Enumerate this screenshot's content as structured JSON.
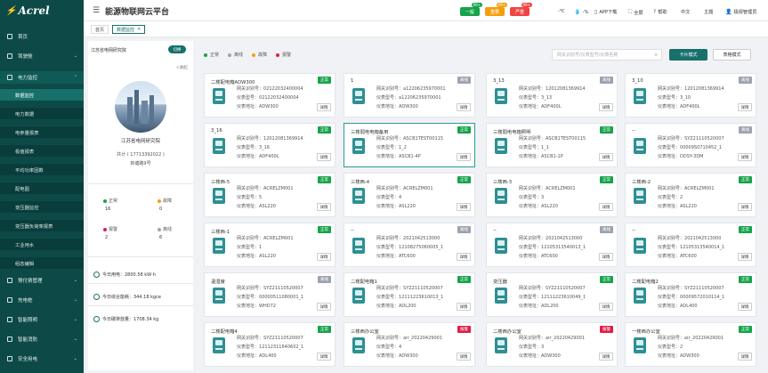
{
  "colors": {
    "sidebar": "#0d4a47",
    "accent": "#17706a",
    "normal": "#16a34a",
    "offline": "#9ca3af",
    "fault": "#f59e0b",
    "alarm": "#e11d48"
  },
  "app": {
    "logo": "Acrel",
    "title": "能源物联网云平台"
  },
  "header": {
    "alarms": [
      {
        "label": "一般",
        "count": "99+",
        "color": "#16a34a"
      },
      {
        "label": "重要",
        "count": "99+",
        "color": "#f59e0b"
      },
      {
        "label": "严重",
        "count": "99+",
        "color": "#ef4444"
      }
    ],
    "temp": "-℃",
    "humidity": "-%",
    "app_download": "APP下载",
    "fullscreen": "全屏",
    "help": "帮助",
    "language": "中文",
    "theme": "主题",
    "account": "极视管理员"
  },
  "sidebar": {
    "items": [
      {
        "label": "首页",
        "icon": "home-icon"
      },
      {
        "label": "驾驶舱",
        "icon": "dashboard-icon"
      },
      {
        "label": "电力监控",
        "icon": "power-icon"
      }
    ],
    "sub_items": [
      {
        "label": "数据监控",
        "active": true
      },
      {
        "label": "电力数据"
      },
      {
        "label": "电参量报表"
      },
      {
        "label": "极值报表"
      },
      {
        "label": "平均功率因数"
      },
      {
        "label": "配电图"
      },
      {
        "label": "变压器监控"
      },
      {
        "label": "变压器负荷率报表"
      },
      {
        "label": "工业用水"
      },
      {
        "label": "组态编辑"
      }
    ],
    "bottom_items": [
      {
        "label": "预付费管理",
        "icon": "prepay-icon"
      },
      {
        "label": "充电桩",
        "icon": "charger-icon"
      },
      {
        "label": "智能照明",
        "icon": "lighting-icon"
      },
      {
        "label": "智能消防",
        "icon": "fire-icon"
      },
      {
        "label": "安全用电",
        "icon": "safety-icon"
      }
    ]
  },
  "tabs": [
    {
      "label": "首页"
    },
    {
      "label": "数据监控",
      "active": true
    }
  ],
  "project": {
    "header": "江苏省电网研究院",
    "switch": "切换",
    "collapse": "<收起",
    "name": "江苏省电网研究院",
    "stations": "共计 ( 17713392022 )",
    "address": "新塘路9号",
    "stats": [
      {
        "label": "正常",
        "value": "16",
        "color": "#16a34a"
      },
      {
        "label": "故障",
        "value": "0",
        "color": "#f59e0b"
      },
      {
        "label": "报警",
        "value": "2",
        "color": "#e11d48"
      },
      {
        "label": "离线",
        "value": "6",
        "color": "#9ca3af"
      }
    ],
    "metrics": [
      "今日用电：2800.58 kW·h",
      "今日综合能耗：344.18 kgce",
      "今日碳排放量：1708.34 kg"
    ]
  },
  "toolbar": {
    "legend": [
      {
        "label": "正常",
        "color": "#16a34a"
      },
      {
        "label": "离线",
        "color": "#9ca3af"
      },
      {
        "label": "故障",
        "color": "#f59e0b"
      },
      {
        "label": "报警",
        "color": "#e11d48"
      }
    ],
    "search_placeholder": "网关识别号/仪表型号/仪表名称",
    "card_mode": "卡片模式",
    "table_mode": "表格模式"
  },
  "card_labels": {
    "gateway": "网关识别号：",
    "model": "仪表型号：",
    "address": "仪表地址：",
    "detail": "详情"
  },
  "devices": [
    {
      "name": "二楼配电箱ADW300",
      "status": "正常",
      "status_color": "#16a34a",
      "gateway": "02122032400004",
      "model": "02122032400004",
      "address": "ADW300"
    },
    {
      "name": "1",
      "status": "离线",
      "status_color": "#9ca3af",
      "gateway": "a12206235970001",
      "model": "a12206235970001",
      "address": "ADW300"
    },
    {
      "name": "3_13",
      "status": "离线",
      "status_color": "#9ca3af",
      "gateway": "12012081369914",
      "model": "3_13",
      "address": "ADF400L"
    },
    {
      "name": "3_10",
      "status": "离线",
      "status_color": "#9ca3af",
      "gateway": "12012081369914",
      "model": "3_10",
      "address": "ADF400L"
    },
    {
      "name": "3_16",
      "status": "正常",
      "status_color": "#16a34a",
      "gateway": "12012081369914",
      "model": "3_16",
      "address": "ADF400L"
    },
    {
      "name": "三楼弱电电箱备用",
      "status": "正常",
      "status_color": "#16a34a",
      "gateway": "ASCB1TEST00115",
      "model": "1_2",
      "address": "ASCB1-4P",
      "highlight": true
    },
    {
      "name": "三楼弱电电箱照明",
      "status": "正常",
      "status_color": "#16a34a",
      "gateway": "ASCB1TEST00115",
      "model": "1_1",
      "address": "ASCB1-1P"
    },
    {
      "name": "--",
      "status": "离线",
      "status_color": "#9ca3af",
      "gateway": "SYZ21110520007",
      "model": "00009S0710452_1",
      "address": "DDSY-3DM"
    },
    {
      "name": "三楼西-5",
      "status": "正常",
      "status_color": "#16a34a",
      "gateway": "ACRELZM001",
      "model": "5",
      "address": "ASL220"
    },
    {
      "name": "三楼西-4",
      "status": "正常",
      "status_color": "#16a34a",
      "gateway": "ACRELZM001",
      "model": "4",
      "address": "ASL220"
    },
    {
      "name": "三楼西-3",
      "status": "正常",
      "status_color": "#16a34a",
      "gateway": "ACRELZM001",
      "model": "3",
      "address": "ASL220"
    },
    {
      "name": "三楼西-2",
      "status": "正常",
      "status_color": "#16a34a",
      "gateway": "ACRELZM001",
      "model": "2",
      "address": "ASL220"
    },
    {
      "name": "三楼西-1",
      "status": "正常",
      "status_color": "#16a34a",
      "gateway": "ACRELZM001",
      "model": "1",
      "address": "ASL220"
    },
    {
      "name": "--",
      "status": "离线",
      "status_color": "#9ca3af",
      "gateway": "2021042513000",
      "model": "12108275060005_1",
      "address": "ATC600"
    },
    {
      "name": "--",
      "status": "离线",
      "status_color": "#9ca3af",
      "gateway": "2021042513000",
      "model": "12105313540013_1",
      "address": "ATC600"
    },
    {
      "name": "--",
      "status": "正常",
      "status_color": "#16a34a",
      "gateway": "2021042513000",
      "model": "12105313540014_1",
      "address": "ATC600"
    },
    {
      "name": "温湿度",
      "status": "离线",
      "status_color": "#9ca3af",
      "gateway": "SYZ21110520007",
      "model": "00000511080001_1",
      "address": "WHD72"
    },
    {
      "name": "二楼配电箱1",
      "status": "正常",
      "status_color": "#16a34a",
      "gateway": "SYZ21110520007",
      "model": "12111223610013_1",
      "address": "ADL200"
    },
    {
      "name": "变压器",
      "status": "正常",
      "status_color": "#16a34a",
      "gateway": "SYZ21110520007",
      "model": "12111223610049_1",
      "address": "ADL200"
    },
    {
      "name": "二楼配电箱2",
      "status": "正常",
      "status_color": "#16a34a",
      "gateway": "SYZ21110520007",
      "model": "00009572010114_1",
      "address": "ADL400"
    },
    {
      "name": "二楼配电箱4",
      "status": "正常",
      "status_color": "#16a34a",
      "gateway": "SYZ21110520007",
      "model": "12112311640602_1",
      "address": "ADL400"
    },
    {
      "name": "三楼西办公室",
      "status": "报警",
      "status_color": "#e11d48",
      "gateway": "air_20220429001",
      "model": "4",
      "address": "ADW300"
    },
    {
      "name": "二楼西办公室",
      "status": "报警",
      "status_color": "#e11d48",
      "gateway": "air_20220429001",
      "model": "3",
      "address": "ADW300"
    },
    {
      "name": "一楼西办公室",
      "status": "正常",
      "status_color": "#16a34a",
      "gateway": "air_20220429001",
      "model": "2",
      "address": "ADW300"
    }
  ]
}
